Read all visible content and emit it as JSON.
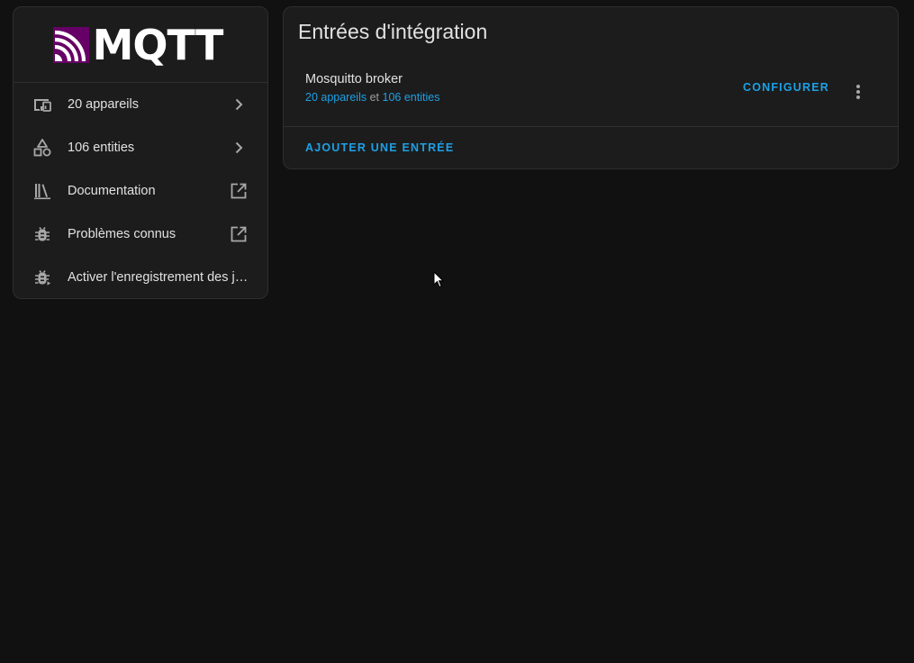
{
  "logo": {
    "word": "MQTT",
    "accent_color": "#660066"
  },
  "sidebar": {
    "items": [
      {
        "label": "20 appareils",
        "icon": "devices-icon",
        "trail": "chevron-right-icon"
      },
      {
        "label": "106 entities",
        "icon": "shapes-icon",
        "trail": "chevron-right-icon"
      },
      {
        "label": "Documentation",
        "icon": "bookshelf-icon",
        "trail": "open-in-new-icon"
      },
      {
        "label": "Problèmes connus",
        "icon": "bug-icon",
        "trail": "open-in-new-icon"
      },
      {
        "label": "Activer l'enregistrement des journaux de débogage",
        "icon": "bug-play-icon",
        "trail": ""
      }
    ]
  },
  "main": {
    "title": "Entrées d'intégration",
    "entry": {
      "name": "Mosquitto broker",
      "devices_link": "20 appareils",
      "connector": "et",
      "entities_link": "106 entities",
      "configure_label": "CONFIGURER"
    },
    "add_entry_label": "AJOUTER UNE ENTRÉE"
  },
  "colors": {
    "background": "#111111",
    "card": "#1c1c1c",
    "accent": "#1ea0e6",
    "text": "#e1e1e1",
    "icon": "#a8a8a8"
  }
}
